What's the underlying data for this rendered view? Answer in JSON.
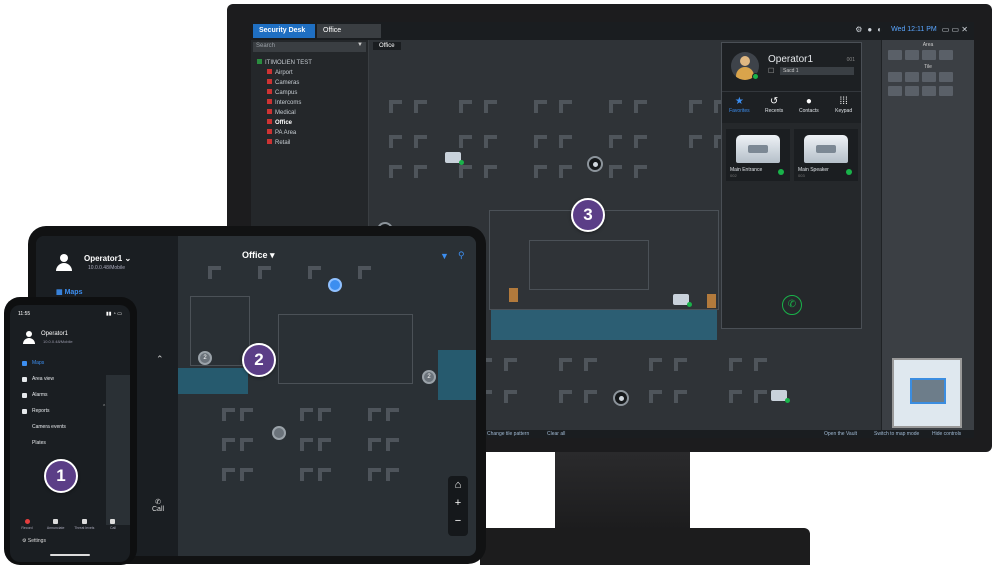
{
  "desktop": {
    "tabs": [
      "Security Desk",
      "Office"
    ],
    "search_placeholder": "Search",
    "tree": {
      "root": "ITIMOLIEN TEST",
      "items": [
        "Airport",
        "Cameras",
        "Campus",
        "Intercoms",
        "Medical",
        "Office",
        "PA Area",
        "Retail"
      ],
      "selected": "Office"
    },
    "map_tab": "Office",
    "clock": "Wed 12:11 PM",
    "bottom_bar": [
      "Change tile pattern",
      "Clear all",
      "Open the Vault",
      "Switch to map mode",
      "Hide controls"
    ],
    "right_panel": {
      "area_title": "Area",
      "tile_title": "Tile"
    },
    "popup": {
      "operator": "Operator1",
      "ext": "001",
      "line": "Sacd 1",
      "tabs": [
        {
          "icon": "star-icon",
          "label": "Favorites"
        },
        {
          "icon": "recent-icon",
          "label": "Recents"
        },
        {
          "icon": "contacts-icon",
          "label": "Contacts"
        },
        {
          "icon": "keypad-icon",
          "label": "Keypad"
        }
      ],
      "cards": [
        {
          "name": "Main Entrance",
          "sub": "002"
        },
        {
          "name": "Main Speaker",
          "sub": "003"
        }
      ]
    }
  },
  "tablet": {
    "user": "Operator1",
    "user_chevron": "⌄",
    "version": "10.0.0.48/Mobile",
    "nav_maps": "Maps",
    "map_title": "Office",
    "call_label": "Call",
    "cam_labels": [
      "2",
      "2"
    ],
    "zoom": [
      "⌂",
      "+",
      "−"
    ]
  },
  "phone": {
    "time": "11:55",
    "user": "Operator1",
    "version": "10.0.0.48/Mobile",
    "menu": [
      {
        "label": "Maps",
        "active": true
      },
      {
        "label": "Area view"
      },
      {
        "label": "Alarms"
      },
      {
        "label": "Reports"
      },
      {
        "label": "Camera events",
        "sub": true
      },
      {
        "label": "Plates",
        "sub": true
      }
    ],
    "dock": [
      "Record",
      "Annunciate",
      "Threat levels",
      "Call"
    ],
    "settings": "Settings"
  },
  "badges": [
    "1",
    "2",
    "3"
  ],
  "colors": {
    "accent": "#3c8ef0",
    "badge": "#5b3e87",
    "status_online": "#19b34a",
    "map_teal": "#2c5e73"
  }
}
